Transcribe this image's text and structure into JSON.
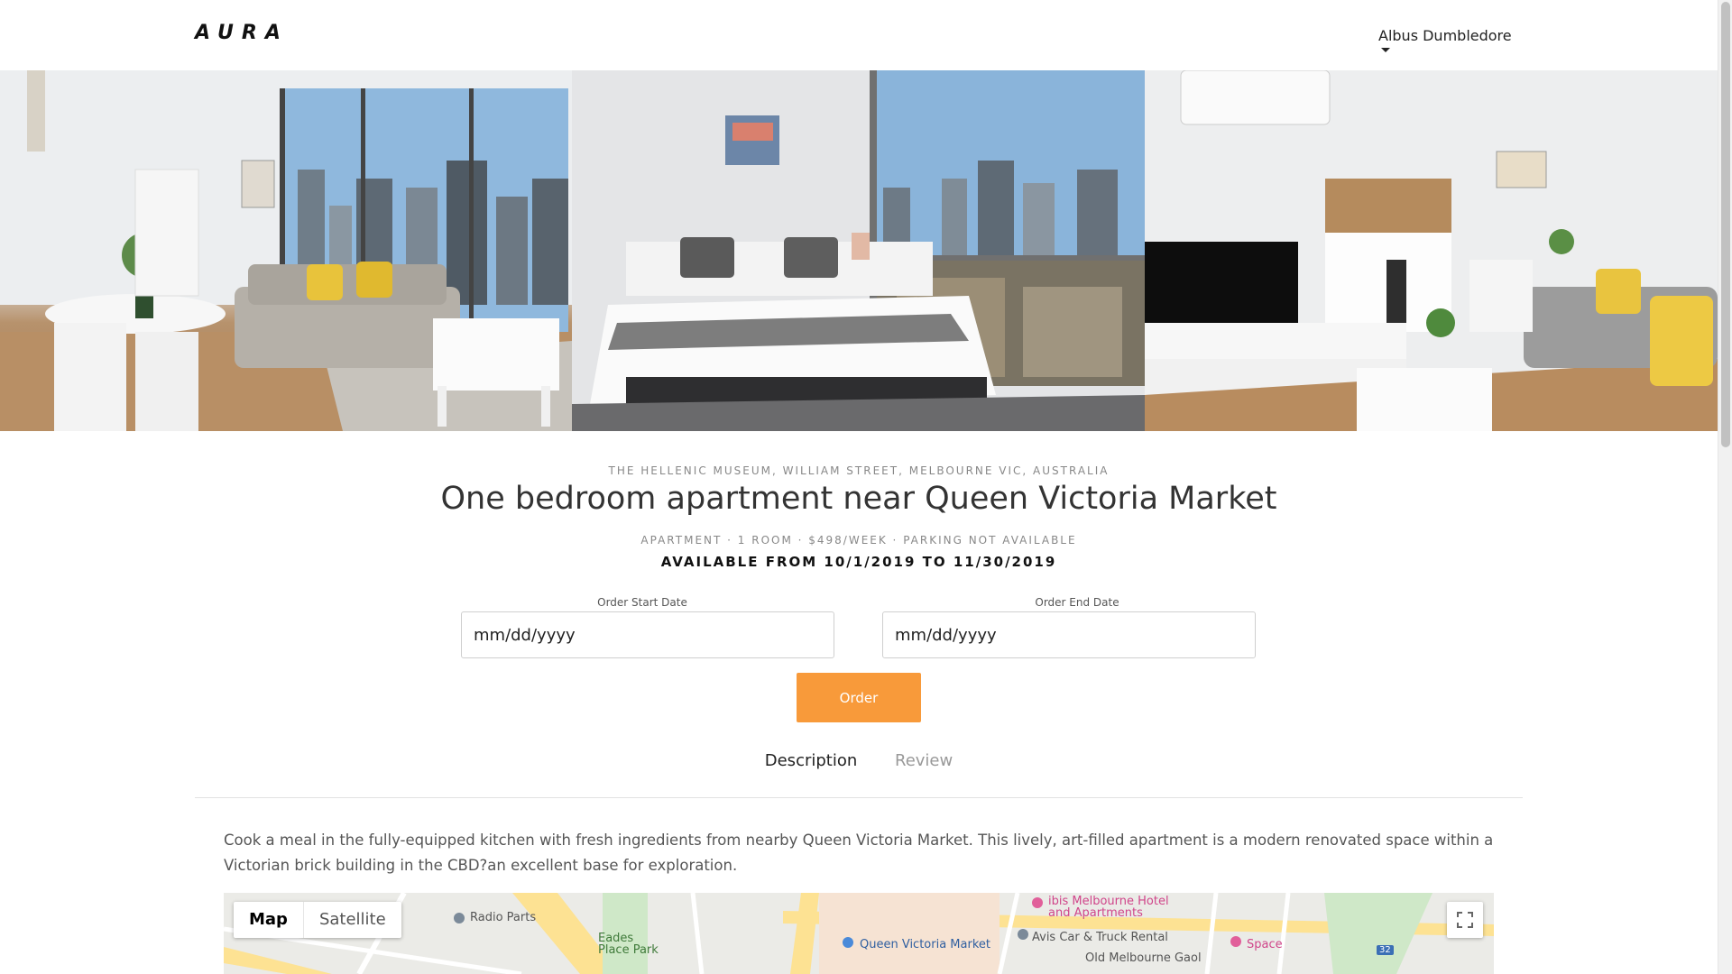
{
  "header": {
    "logo": "AURA",
    "user_name": "Albus Dumbledore"
  },
  "hero": {
    "photos": [
      "living-room-photo",
      "bedroom-photo",
      "kitchen-lounge-photo"
    ]
  },
  "listing": {
    "address": "THE HELLENIC MUSEUM, WILLIAM STREET, MELBOURNE VIC, AUSTRALIA",
    "title": "One bedroom apartment near Queen Victoria Market",
    "meta": "APARTMENT · 1 ROOM · $498/WEEK · PARKING NOT AVAILABLE",
    "availability": "AVAILABLE FROM 10/1/2019 TO 11/30/2019"
  },
  "order_form": {
    "start_label": "Order Start Date",
    "start_placeholder": "mm/dd/yyyy",
    "end_label": "Order End Date",
    "end_placeholder": "mm/dd/yyyy",
    "button_label": "Order",
    "button_color": "#f89a3a"
  },
  "tabs": [
    {
      "label": "Description",
      "active": true
    },
    {
      "label": "Review",
      "active": false
    }
  ],
  "description": "Cook a meal in the fully-equipped kitchen with fresh ingredients from nearby Queen Victoria Market. This lively, art-filled apartment is a modern renovated space within a Victorian brick building in the CBD?an excellent base for exploration.",
  "map": {
    "type_buttons": [
      "Map",
      "Satellite"
    ],
    "labels": {
      "radio_parts": "Radio Parts",
      "eades": "Eades",
      "place_park": "Place Park",
      "qvm": "Queen Victoria Market",
      "ibis_1": "ibis Melbourne Hotel",
      "ibis_2": "and Apartments",
      "avis": "Avis Car & Truck Rental",
      "old_gaol": "Old Melbourne Gaol",
      "space": "Space",
      "route": "32"
    }
  }
}
